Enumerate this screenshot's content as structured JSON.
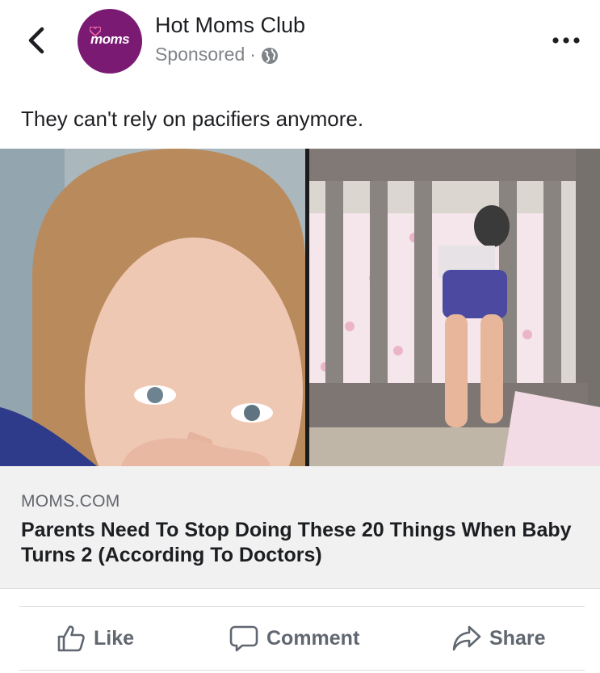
{
  "header": {
    "page_name": "Hot Moms Club",
    "sponsored_label": "Sponsored",
    "meta_separator": "·",
    "avatar_text": "moms",
    "back_icon": "chevron-left-icon",
    "more_icon": "ellipsis-icon",
    "globe_icon": "globe-icon"
  },
  "post": {
    "caption": "They can't rely on pacifiers anymore."
  },
  "link_preview": {
    "domain": "MOMS.COM",
    "title": "Parents Need To Stop Doing These 20 Things When Baby Turns 2 (According To Doctors)"
  },
  "actions": {
    "like_label": "Like",
    "comment_label": "Comment",
    "share_label": "Share"
  },
  "colors": {
    "brand_purple": "#7a1a73",
    "action_gray": "#606770",
    "meta_gray": "#7f8388",
    "link_bg": "#f1f1f2"
  }
}
